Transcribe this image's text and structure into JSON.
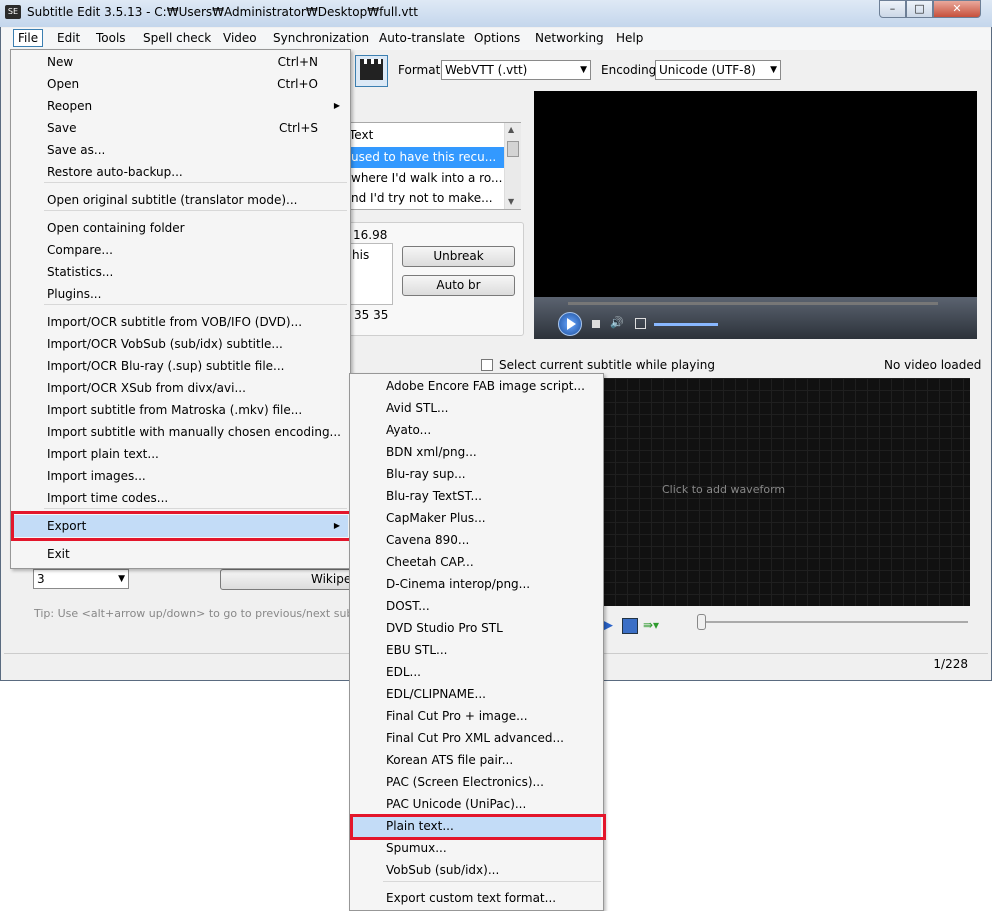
{
  "titlebar": {
    "title": "Subtitle Edit 3.5.13 - C:₩Users₩Administrator₩Desktop₩full.vtt",
    "icon": "SE"
  },
  "menubar": [
    "File",
    "Edit",
    "Tools",
    "Spell check",
    "Video",
    "Synchronization",
    "Auto-translate",
    "Options",
    "Networking",
    "Help"
  ],
  "toolbar": {
    "format_label": "Format",
    "format_value": "WebVTT (.vtt)",
    "encoding_label": "Encoding",
    "encoding_value": "Unicode (UTF-8)"
  },
  "subtitle_list": {
    "header": "Text",
    "rows": [
      "used to have this recu...",
      "where I'd walk into a ro...",
      "nd I'd try not to make..."
    ]
  },
  "edit": {
    "duration": "16.98",
    "text": "his",
    "counts": "35 35",
    "unbreak": "Unbreak",
    "auto_br": "Auto br"
  },
  "video": {
    "select_current": "Select current subtitle while playing",
    "no_video": "No video loaded"
  },
  "waveform": {
    "placeholder": "Click to add waveform"
  },
  "bottom": {
    "spin_value": "3",
    "wiki_button": "Wikipe",
    "tip": "Tip: Use <alt+arrow up/down> to go to previous/next subt"
  },
  "status": {
    "position": "1/228"
  },
  "file_menu": [
    {
      "label": "New",
      "shortcut": "Ctrl+N"
    },
    {
      "label": "Open",
      "shortcut": "Ctrl+O"
    },
    {
      "label": "Reopen",
      "submenu": true
    },
    {
      "label": "Save",
      "shortcut": "Ctrl+S"
    },
    {
      "label": "Save as..."
    },
    {
      "label": "Restore auto-backup..."
    },
    {
      "label": "Open original subtitle (translator mode)..."
    },
    {
      "label": "Open containing folder"
    },
    {
      "label": "Compare..."
    },
    {
      "label": "Statistics..."
    },
    {
      "label": "Plugins..."
    },
    {
      "label": "Import/OCR subtitle from VOB/IFO (DVD)..."
    },
    {
      "label": "Import/OCR VobSub (sub/idx) subtitle..."
    },
    {
      "label": "Import/OCR Blu-ray (.sup) subtitle file..."
    },
    {
      "label": "Import/OCR XSub from divx/avi..."
    },
    {
      "label": "Import subtitle from Matroska (.mkv) file..."
    },
    {
      "label": "Import subtitle with manually chosen encoding..."
    },
    {
      "label": "Import plain text..."
    },
    {
      "label": "Import images..."
    },
    {
      "label": "Import time codes..."
    },
    {
      "label": "Export",
      "submenu": true
    },
    {
      "label": "Exit"
    }
  ],
  "export_menu": [
    "Adobe Encore FAB image script...",
    "Avid STL...",
    "Ayato...",
    "BDN xml/png...",
    "Blu-ray sup...",
    "Blu-ray TextST...",
    "CapMaker Plus...",
    "Cavena 890...",
    "Cheetah CAP...",
    "D-Cinema interop/png...",
    "DOST...",
    "DVD Studio Pro STL",
    "EBU STL...",
    "EDL...",
    "EDL/CLIPNAME...",
    "Final Cut Pro + image...",
    "Final Cut Pro XML advanced...",
    "Korean ATS file pair...",
    "PAC (Screen Electronics)...",
    "PAC Unicode (UniPac)...",
    "Plain text...",
    "Spumux...",
    "VobSub (sub/idx)...",
    "Export custom text format..."
  ],
  "colors": {
    "highlight": "#c3dcf7",
    "annotation": "#e3162b",
    "selection": "#3399ff"
  }
}
